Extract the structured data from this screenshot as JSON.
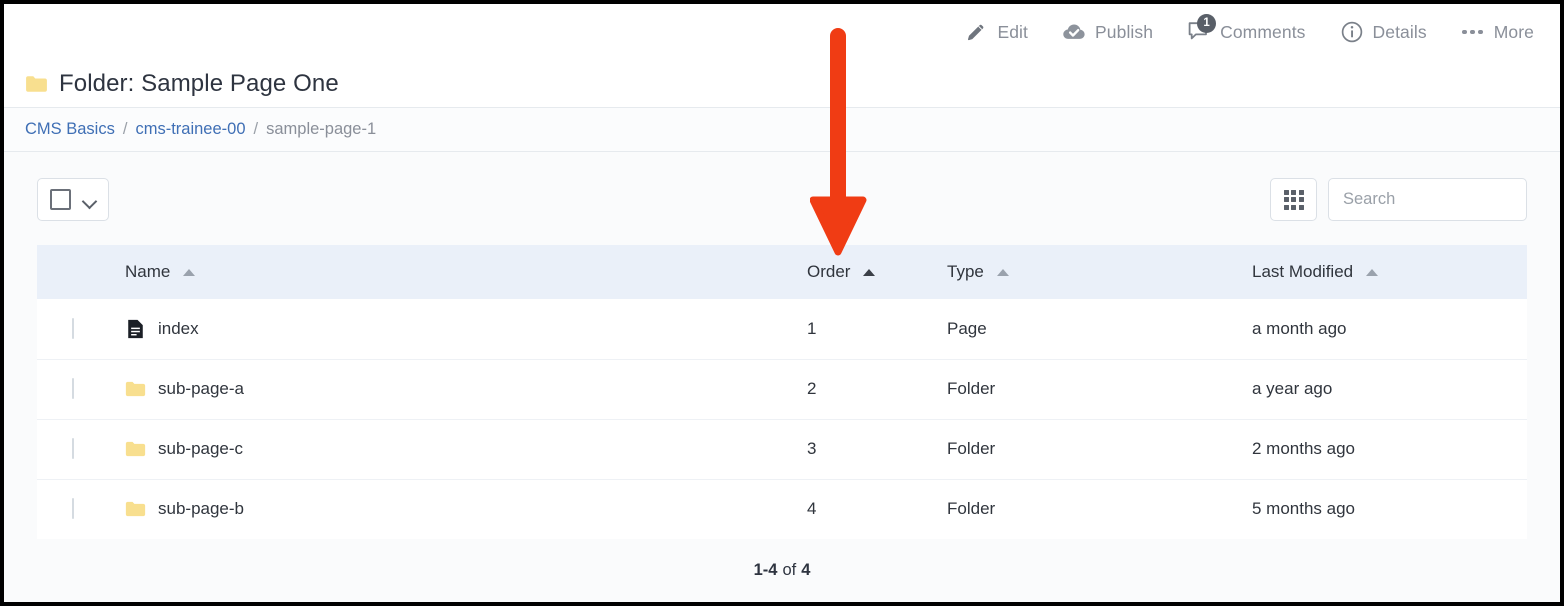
{
  "action_bar": {
    "items": [
      {
        "label": "Edit",
        "icon": "pencil-icon",
        "badge": null
      },
      {
        "label": "Publish",
        "icon": "cloud-check-icon",
        "badge": null
      },
      {
        "label": "Comments",
        "icon": "comment-bubble-icon",
        "badge": "1"
      },
      {
        "label": "Details",
        "icon": "info-circle-icon",
        "badge": null
      },
      {
        "label": "More",
        "icon": "ellipsis-icon",
        "badge": null
      }
    ]
  },
  "header": {
    "title": "Folder: Sample Page One",
    "title_icon": "folder-icon"
  },
  "breadcrumb": {
    "items": [
      {
        "label": "CMS Basics",
        "type": "link"
      },
      {
        "label": "cms-trainee-00",
        "type": "link"
      },
      {
        "label": "sample-page-1",
        "type": "current"
      }
    ],
    "separator": "/"
  },
  "toolbar": {
    "select_all": {
      "name": "select-all-dropdown",
      "checked": false
    },
    "grid_button": {
      "icon": "grid-view-icon"
    },
    "search": {
      "value": "",
      "placeholder": "Search"
    }
  },
  "table": {
    "columns": [
      {
        "key": "checkbox",
        "label": "",
        "sortable": false,
        "sort_active": false
      },
      {
        "key": "name",
        "label": "Name",
        "sortable": true,
        "sort_active": false
      },
      {
        "key": "order",
        "label": "Order",
        "sortable": true,
        "sort_active": true
      },
      {
        "key": "type",
        "label": "Type",
        "sortable": true,
        "sort_active": false
      },
      {
        "key": "modified",
        "label": "Last Modified",
        "sortable": true,
        "sort_active": false
      }
    ],
    "rows": [
      {
        "icon": "page-icon",
        "name": "index",
        "order": "1",
        "type": "Page",
        "modified": "a month ago"
      },
      {
        "icon": "folder-icon",
        "name": "sub-page-a",
        "order": "2",
        "type": "Folder",
        "modified": "a year ago"
      },
      {
        "icon": "folder-icon",
        "name": "sub-page-c",
        "order": "3",
        "type": "Folder",
        "modified": "2 months ago"
      },
      {
        "icon": "folder-icon",
        "name": "sub-page-b",
        "order": "4",
        "type": "Folder",
        "modified": "5 months ago"
      }
    ]
  },
  "footer": {
    "range": "1-4",
    "of": "of",
    "total": "4"
  },
  "annotation": {
    "type": "down-arrow",
    "points_at": "Order",
    "color": "#f03c14"
  },
  "colors": {
    "link": "#3f6fb5",
    "header_row_bg": "#eaf0f9",
    "folder_icon": "#f8df8f",
    "annotation": "#f03c14",
    "page_bg": "#fafbfc"
  }
}
